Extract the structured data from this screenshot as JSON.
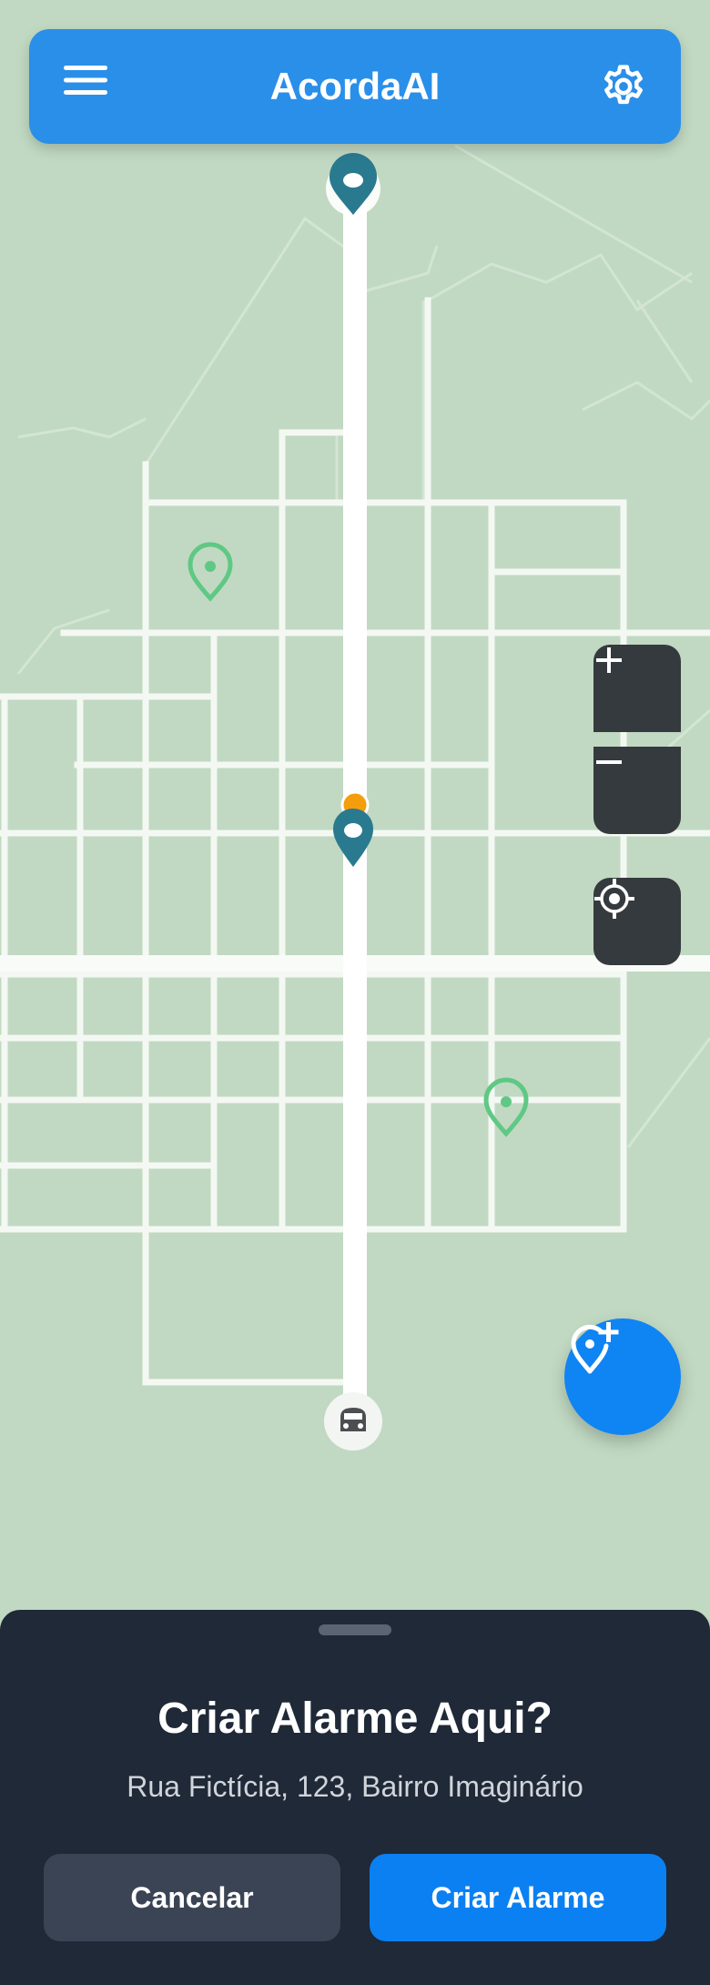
{
  "header": {
    "title": "AcordaAI",
    "menu_icon": "hamburger-menu-icon",
    "settings_icon": "gear-icon"
  },
  "map": {
    "controls": {
      "zoom_in_icon": "plus-icon",
      "zoom_out_icon": "minus-icon",
      "locate_icon": "crosshair-icon"
    },
    "markers": [
      {
        "name": "route-start-pin",
        "icon": "map-pin-icon",
        "color": "#2a7a8f"
      },
      {
        "name": "selected-location-pin",
        "icon": "map-pin-icon",
        "color": "#2a7a8f"
      },
      {
        "name": "current-location-dot",
        "icon": "dot-icon",
        "color": "#f59e0b"
      },
      {
        "name": "saved-alarm-pin",
        "icon": "map-pin-outline-icon",
        "color": "#5fc884"
      },
      {
        "name": "saved-alarm-pin",
        "icon": "map-pin-outline-icon",
        "color": "#5fc884"
      },
      {
        "name": "route-end-marker",
        "icon": "bus-icon",
        "color": "#ffffff"
      }
    ],
    "fab_icon": "add-location-icon"
  },
  "sheet": {
    "title": "Criar Alarme Aqui?",
    "address": "Rua Fictícia, 123, Bairro Imaginário",
    "cancel_label": "Cancelar",
    "create_label": "Criar Alarme"
  },
  "colors": {
    "primary": "#2a8fe9",
    "accent": "#0b80f2",
    "sheet_bg": "#1f2937",
    "map_bg": "#c1d9c2"
  }
}
